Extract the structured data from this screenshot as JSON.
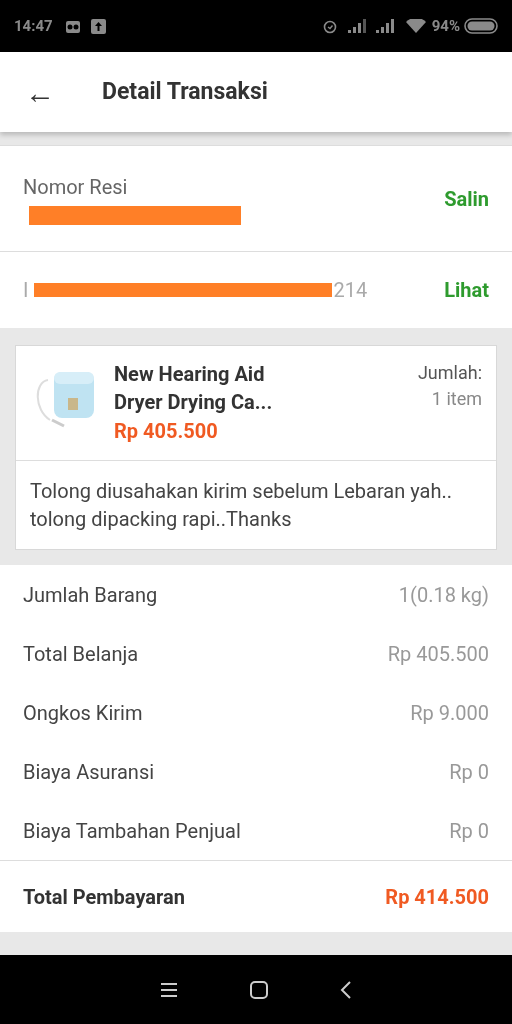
{
  "status_bar": {
    "time": "14:47",
    "battery": "94%"
  },
  "header": {
    "back": "←",
    "title": "Detail Transaksi"
  },
  "resi": {
    "label": "Nomor Resi",
    "action": "Salin"
  },
  "invoice": {
    "start": "I",
    "end": "214",
    "action": "Lihat"
  },
  "product": {
    "kind": "picture",
    "name": "New Hearing Aid Dryer Drying Ca...",
    "price": "Rp 405.500",
    "qty_label": "Jumlah:",
    "qty": "1 item",
    "note": "Tolong diusahakan kirim sebelum Lebaran yah.. tolong dipacking rapi..Thanks"
  },
  "summary": [
    {
      "label": "Jumlah Barang",
      "value": "1(0.18 kg)"
    },
    {
      "label": "Total Belanja",
      "value": "Rp 405.500"
    },
    {
      "label": "Ongkos Kirim",
      "value": "Rp 9.000"
    },
    {
      "label": "Biaya Asuransi",
      "value": "Rp 0"
    },
    {
      "label": "Biaya Tambahan Penjual",
      "value": "Rp 0"
    }
  ],
  "total": {
    "label": "Total Pembayaran",
    "value": "Rp 414.500"
  }
}
